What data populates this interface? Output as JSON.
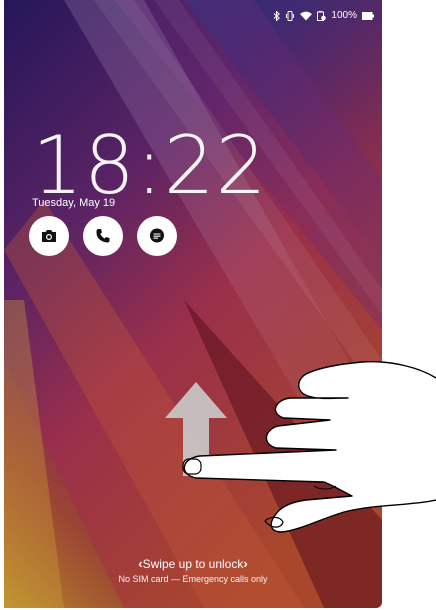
{
  "status_bar": {
    "icons": [
      "bluetooth-icon",
      "vibrate-icon",
      "wifi-icon",
      "battery-saver-icon",
      "battery-icon"
    ],
    "battery_percent": "100%"
  },
  "lock_screen": {
    "time": "18:22",
    "date": "Tuesday, May 19",
    "shortcuts": [
      {
        "name": "camera",
        "icon": "camera-icon"
      },
      {
        "name": "phone",
        "icon": "phone-icon"
      },
      {
        "name": "messages",
        "icon": "message-icon"
      }
    ],
    "swipe_hint": "Swipe up to unlock",
    "sim_status": "No SIM card — Emergency calls only"
  },
  "colors": {
    "wallpaper_top": "#2a1a5e",
    "wallpaper_mid": "#8a2a52",
    "wallpaper_bottom": "#c28a2a",
    "shortcut_icon": "#111111"
  }
}
